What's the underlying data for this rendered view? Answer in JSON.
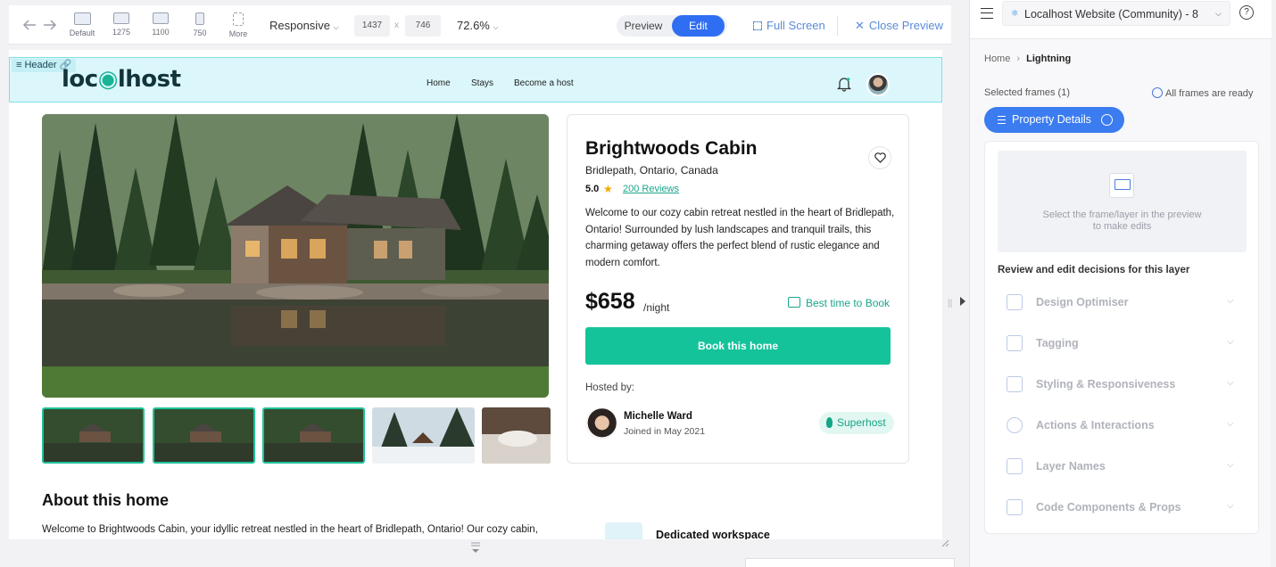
{
  "toolbar": {
    "devices": [
      {
        "label": "Default"
      },
      {
        "label": "1275"
      },
      {
        "label": "1100"
      },
      {
        "label": "750"
      },
      {
        "label": "More"
      }
    ],
    "mode_label": "Responsive",
    "width": "1437",
    "times": "x",
    "height": "746",
    "zoom": "72.6%",
    "preview_label": "Preview",
    "edit_label": "Edit",
    "fullscreen_label": "Full Screen",
    "close_label": "Close Preview"
  },
  "site": {
    "header_tag": "Header",
    "logo_a": "loc",
    "logo_b": "lhost",
    "nav": [
      "Home",
      "Stays",
      "Become a host"
    ],
    "property": {
      "title": "Brightwoods Cabin",
      "location": "Bridlepath, Ontario, Canada",
      "rating": "5.0",
      "reviews": "200 Reviews",
      "description": "Welcome to our cozy cabin retreat nestled in the heart of Bridlepath, Ontario! Surrounded by lush landscapes and tranquil trails, this charming getaway offers the perfect blend of rustic elegance and modern comfort.",
      "price": "$658",
      "per_night": "/night",
      "best_time": "Best time to Book",
      "book_label": "Book this home",
      "hosted_by": "Hosted by:",
      "host_name": "Michelle Ward",
      "host_since": "Joined in May 2021",
      "superhost": "Superhost"
    },
    "about_title": "About this home",
    "about_text": "Welcome to Brightwoods Cabin, your idyllic retreat nestled in the heart of Bridlepath, Ontario! Our cozy cabin,",
    "workspace_label": "Dedicated workspace"
  },
  "panel": {
    "project": "Localhost Website (Community) - 8",
    "help": "?",
    "breadcrumb_home": "Home",
    "breadcrumb_current": "Lightning",
    "selected_frames": "Selected frames (1)",
    "frames_ready": "All frames are ready",
    "frame_pill": "Property Details",
    "empty_line1": "Select the frame/layer in the preview",
    "empty_line2": "to make edits",
    "review_heading": "Review and edit decisions for this layer",
    "sections": [
      {
        "label": "Design Optimiser",
        "icon": "design-optimiser-icon"
      },
      {
        "label": "Tagging",
        "icon": "tagging-icon"
      },
      {
        "label": "Styling & Responsiveness",
        "icon": "styling-icon"
      },
      {
        "label": "Actions & Interactions",
        "icon": "actions-icon"
      },
      {
        "label": "Layer Names",
        "icon": "layer-names-icon"
      },
      {
        "label": "Code Components & Props",
        "icon": "code-components-icon"
      }
    ]
  },
  "colors": {
    "accent_blue": "#2f6df2",
    "brand_green": "#14c39a",
    "header_highlight": "#dcf7fb"
  }
}
